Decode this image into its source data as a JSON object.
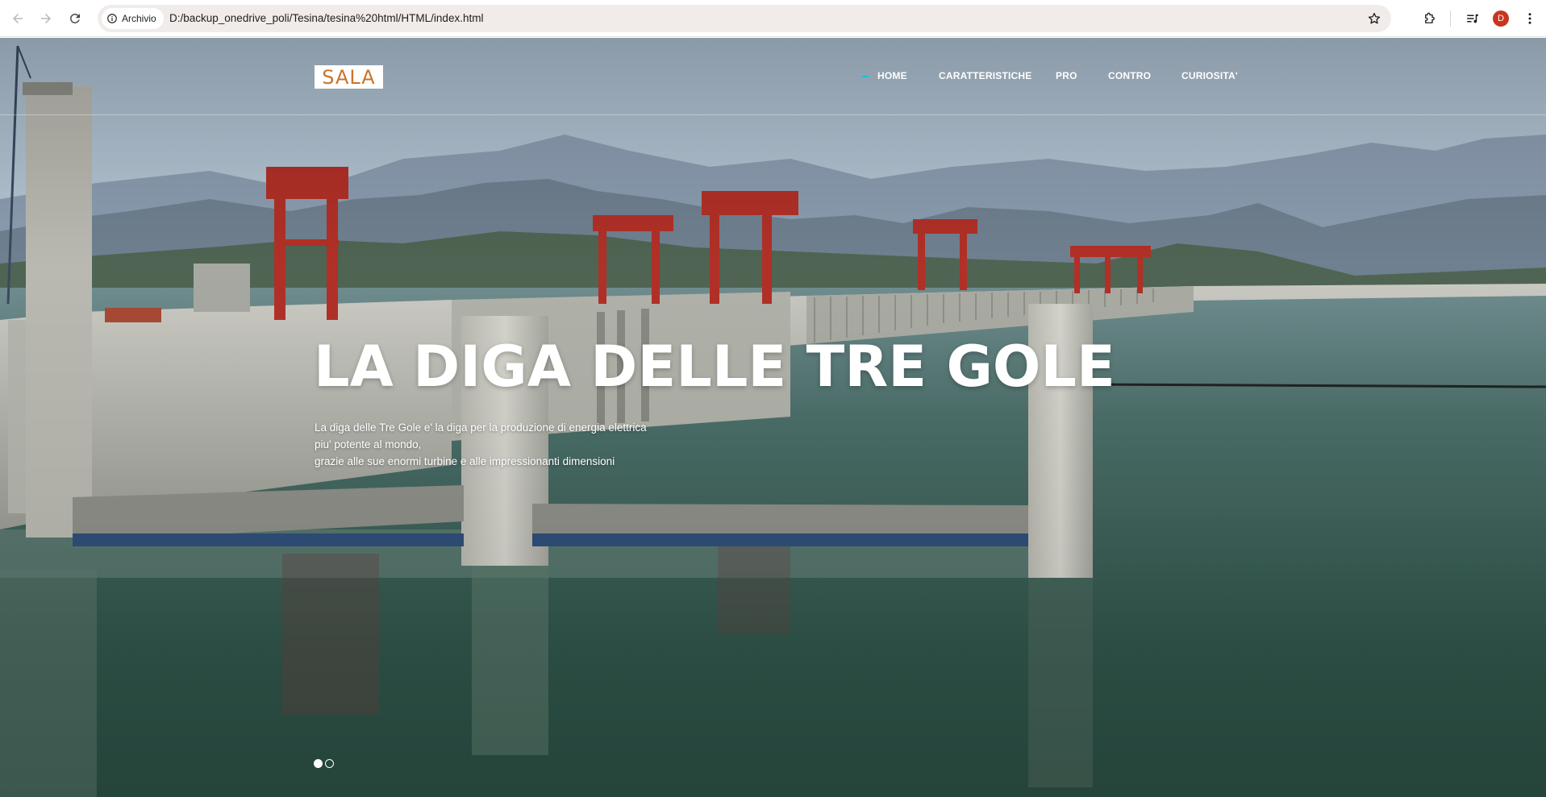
{
  "browser": {
    "site_chip_label": "Archivio",
    "url": "D:/backup_onedrive_poli/Tesina/tesina%20html/HTML/index.html",
    "profile_initial": "D",
    "icons": [
      "back-arrow-icon",
      "forward-arrow-icon",
      "reload-icon",
      "info-icon",
      "star-icon",
      "extensions-icon",
      "media-control-icon",
      "menu-kebab-icon"
    ]
  },
  "site": {
    "logo_text": "SALA",
    "nav": [
      {
        "label": "HOME",
        "active": true
      },
      {
        "label": "CARATTERISTICHE",
        "active": false
      },
      {
        "label": "PRO",
        "active": false
      },
      {
        "label": "CONTRO",
        "active": false
      },
      {
        "label": "CURIOSITA'",
        "active": false
      }
    ],
    "hero": {
      "title": "LA DIGA DELLE TRE GOLE",
      "description_lines": [
        "La diga delle Tre Gole e' la diga per la produzione di energia elettrica",
        "piu' potente al mondo,",
        "grazie alle sue enormi turbine e alle impressionanti dimensioni"
      ],
      "slides": 2,
      "active_slide": 1
    }
  },
  "colors": {
    "accent": "#18c3d8",
    "logo": "#c9742c",
    "profile": "#c8361d"
  }
}
